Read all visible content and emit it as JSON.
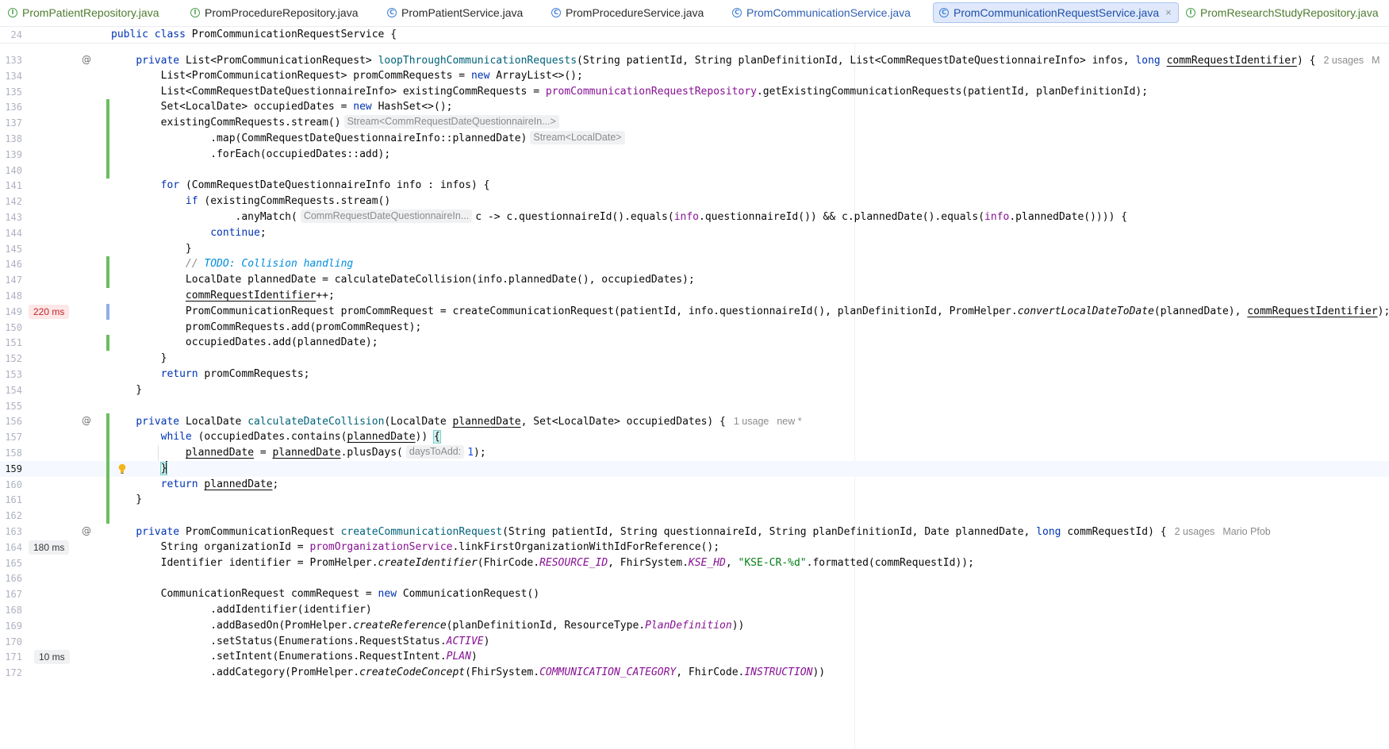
{
  "tabs": [
    {
      "label": "PromPatientRepository.java",
      "kind": "interface",
      "color": "green",
      "active": false
    },
    {
      "label": "PromProcedureRepository.java",
      "kind": "interface",
      "color": "dark",
      "active": false
    },
    {
      "label": "PromPatientService.java",
      "kind": "class",
      "color": "dark",
      "active": false
    },
    {
      "label": "PromProcedureService.java",
      "kind": "class",
      "color": "dark",
      "active": false
    },
    {
      "label": "PromCommunicationService.java",
      "kind": "class",
      "color": "blue",
      "active": false
    },
    {
      "label": "PromCommunicationRequestService.java",
      "kind": "class",
      "color": "active",
      "active": true
    },
    {
      "label": "PromResearchStudyRepository.java",
      "kind": "interface",
      "color": "green",
      "active": false
    }
  ],
  "tab_icons": {
    "interface": "I",
    "class": "C",
    "close": "×"
  },
  "gutter": {
    "override_icon": "@",
    "perf": {
      "149": "220 ms",
      "164": "180 ms",
      "171": "10 ms"
    }
  },
  "code": {
    "sticky_number": "24",
    "sticky_line": [
      [
        "public class ",
        "kw"
      ],
      [
        "PromCommunicationRequestService {",
        ""
      ]
    ],
    "lines": [
      {
        "n": "133",
        "seg": [
          [
            "    ",
            ""
          ],
          [
            "private ",
            "kw"
          ],
          [
            "List<PromCommunicationRequest> ",
            ""
          ],
          [
            "loopThroughCommunicationRequests",
            "fn"
          ],
          [
            "(String patientId, String planDefinitionId, List<CommRequestDateQuestionnaireInfo> infos, ",
            ""
          ],
          [
            "long ",
            "kw"
          ],
          [
            "commRequestIdentifier",
            "ul"
          ],
          [
            ") {",
            ""
          ],
          [
            "2 usages",
            "inlay"
          ],
          [
            "M",
            "inlay"
          ]
        ]
      },
      {
        "n": "134",
        "seg": [
          [
            "        List<PromCommunicationRequest> promCommRequests = ",
            ""
          ],
          [
            "new ",
            "kw"
          ],
          [
            "ArrayList<>();",
            ""
          ]
        ]
      },
      {
        "n": "135",
        "seg": [
          [
            "        List<CommRequestDateQuestionnaireInfo> existingCommRequests = ",
            ""
          ],
          [
            "promCommunicationRequestRepository",
            "field"
          ],
          [
            ".getExistingCommunicationRequests(patientId, planDefinitionId);",
            ""
          ]
        ]
      },
      {
        "n": "136",
        "seg": [
          [
            "        Set<LocalDate> occupiedDates = ",
            ""
          ],
          [
            "new ",
            "kw"
          ],
          [
            "HashSet<>();",
            ""
          ]
        ]
      },
      {
        "n": "137",
        "seg": [
          [
            "        existingCommRequests.stream()",
            ""
          ],
          [
            "Stream<CommRequestDateQuestionnaireIn...>",
            "hint"
          ]
        ]
      },
      {
        "n": "138",
        "seg": [
          [
            "                .map(CommRequestDateQuestionnaireInfo::plannedDate)",
            ""
          ],
          [
            "Stream<LocalDate>",
            "hint"
          ]
        ]
      },
      {
        "n": "139",
        "seg": [
          [
            "                .forEach(occupiedDates::add);",
            ""
          ]
        ]
      },
      {
        "n": "140",
        "seg": []
      },
      {
        "n": "141",
        "seg": [
          [
            "        ",
            ""
          ],
          [
            "for ",
            "kw"
          ],
          [
            "(CommRequestDateQuestionnaireInfo info : infos) {",
            ""
          ]
        ]
      },
      {
        "n": "142",
        "seg": [
          [
            "            ",
            ""
          ],
          [
            "if ",
            "kw"
          ],
          [
            "(existingCommRequests.stream()",
            ""
          ]
        ]
      },
      {
        "n": "143",
        "seg": [
          [
            "                    .anyMatch(",
            ""
          ],
          [
            "CommRequestDateQuestionnaireIn...",
            "hint"
          ],
          [
            "c -> c.questionnaireId().equals(",
            ""
          ],
          [
            "info",
            "field"
          ],
          [
            ".questionnaireId()) && c.plannedDate().equals(",
            ""
          ],
          [
            "info",
            "field"
          ],
          [
            ".plannedDate()))) {",
            ""
          ]
        ]
      },
      {
        "n": "144",
        "seg": [
          [
            "                ",
            ""
          ],
          [
            "continue",
            "kw"
          ],
          [
            ";",
            ""
          ]
        ]
      },
      {
        "n": "145",
        "seg": [
          [
            "            }",
            ""
          ]
        ]
      },
      {
        "n": "146",
        "seg": [
          [
            "            ",
            ""
          ],
          [
            "// ",
            "cmt"
          ],
          [
            "TODO: Collision handling",
            "todo"
          ]
        ]
      },
      {
        "n": "147",
        "seg": [
          [
            "            LocalDate plannedDate = calculateDateCollision(info.plannedDate(), occupiedDates);",
            ""
          ]
        ]
      },
      {
        "n": "148",
        "seg": [
          [
            "            ",
            ""
          ],
          [
            "commRequestIdentifier",
            "ul"
          ],
          [
            "++;",
            ""
          ]
        ]
      },
      {
        "n": "149",
        "seg": [
          [
            "            PromCommunicationRequest promCommRequest = createCommunicationRequest(patientId, info.questionnaireId(), planDefinitionId, PromHelper.",
            ""
          ],
          [
            "convertLocalDateToDate",
            "static"
          ],
          [
            "(plannedDate), ",
            ""
          ],
          [
            "commRequestIdentifier",
            "ul"
          ],
          [
            ");",
            ""
          ]
        ]
      },
      {
        "n": "150",
        "seg": [
          [
            "            promCommRequests.add(promCommRequest);",
            ""
          ]
        ]
      },
      {
        "n": "151",
        "seg": [
          [
            "            occupiedDates.add(plannedDate);",
            ""
          ]
        ]
      },
      {
        "n": "152",
        "seg": [
          [
            "        }",
            ""
          ]
        ]
      },
      {
        "n": "153",
        "seg": [
          [
            "        ",
            ""
          ],
          [
            "return ",
            "kw"
          ],
          [
            "promCommRequests;",
            ""
          ]
        ]
      },
      {
        "n": "154",
        "seg": [
          [
            "    }",
            ""
          ]
        ]
      },
      {
        "n": "155",
        "seg": []
      },
      {
        "n": "156",
        "seg": [
          [
            "    ",
            ""
          ],
          [
            "private ",
            "kw"
          ],
          [
            "LocalDate ",
            ""
          ],
          [
            "calculateDateCollision",
            "fn"
          ],
          [
            "(LocalDate ",
            ""
          ],
          [
            "plannedDate",
            "ul"
          ],
          [
            ", Set<LocalDate> occupiedDates) {",
            ""
          ],
          [
            "1 usage",
            "inlay"
          ],
          [
            "new *",
            "inlay"
          ]
        ]
      },
      {
        "n": "157",
        "seg": [
          [
            "        ",
            ""
          ],
          [
            "while ",
            "kw"
          ],
          [
            "(occupiedDates.contains(",
            ""
          ],
          [
            "plannedDate",
            "ul"
          ],
          [
            ")) ",
            ""
          ],
          [
            "{",
            "match"
          ]
        ]
      },
      {
        "n": "158",
        "seg": [
          [
            "            ",
            ""
          ],
          [
            "plannedDate",
            "ul"
          ],
          [
            " = ",
            ""
          ],
          [
            "plannedDate",
            "ul"
          ],
          [
            ".plusDays(",
            ""
          ],
          [
            "daysToAdd:",
            "hint"
          ],
          [
            "1",
            "num"
          ],
          [
            ");",
            ""
          ]
        ]
      },
      {
        "n": "159",
        "seg": [
          [
            "        ",
            ""
          ],
          [
            "}",
            "match"
          ],
          [
            "",
            "caret"
          ]
        ]
      },
      {
        "n": "160",
        "seg": [
          [
            "        ",
            ""
          ],
          [
            "return ",
            "kw"
          ],
          [
            "plannedDate",
            "ul"
          ],
          [
            ";",
            ""
          ]
        ]
      },
      {
        "n": "161",
        "seg": [
          [
            "    }",
            ""
          ]
        ]
      },
      {
        "n": "162",
        "seg": []
      },
      {
        "n": "163",
        "seg": [
          [
            "    ",
            ""
          ],
          [
            "private ",
            "kw"
          ],
          [
            "PromCommunicationRequest ",
            ""
          ],
          [
            "createCommunicationRequest",
            "fn"
          ],
          [
            "(String patientId, String questionnaireId, String planDefinitionId, Date plannedDate, ",
            ""
          ],
          [
            "long ",
            "kw"
          ],
          [
            "commRequestId) {",
            ""
          ],
          [
            "2 usages",
            "inlay"
          ],
          [
            "Mario Pfob",
            "inlay"
          ]
        ]
      },
      {
        "n": "164",
        "seg": [
          [
            "        String organizationId = ",
            ""
          ],
          [
            "promOrganizationService",
            "field"
          ],
          [
            ".linkFirstOrganizationWithIdForReference();",
            ""
          ]
        ]
      },
      {
        "n": "165",
        "seg": [
          [
            "        Identifier identifier = PromHelper.",
            ""
          ],
          [
            "createIdentifier",
            "static"
          ],
          [
            "(FhirCode.",
            ""
          ],
          [
            "RESOURCE_ID",
            "const"
          ],
          [
            ", FhirSystem.",
            ""
          ],
          [
            "KSE_HD",
            "const"
          ],
          [
            ", ",
            ""
          ],
          [
            "\"KSE-CR-%d\"",
            "str"
          ],
          [
            ".formatted(commRequestId));",
            ""
          ]
        ]
      },
      {
        "n": "166",
        "seg": []
      },
      {
        "n": "167",
        "seg": [
          [
            "        CommunicationRequest commRequest = ",
            ""
          ],
          [
            "new ",
            "kw"
          ],
          [
            "CommunicationRequest()",
            ""
          ]
        ]
      },
      {
        "n": "168",
        "seg": [
          [
            "                .addIdentifier(identifier)",
            ""
          ]
        ]
      },
      {
        "n": "169",
        "seg": [
          [
            "                .addBasedOn(PromHelper.",
            ""
          ],
          [
            "createReference",
            "static"
          ],
          [
            "(planDefinitionId, ResourceType.",
            ""
          ],
          [
            "PlanDefinition",
            "const"
          ],
          [
            "))",
            ""
          ]
        ]
      },
      {
        "n": "170",
        "seg": [
          [
            "                .setStatus(Enumerations.RequestStatus.",
            ""
          ],
          [
            "ACTIVE",
            "const"
          ],
          [
            ")",
            ""
          ]
        ]
      },
      {
        "n": "171",
        "seg": [
          [
            "                .setIntent(Enumerations.RequestIntent.",
            ""
          ],
          [
            "PLAN",
            "const"
          ],
          [
            ")",
            ""
          ]
        ]
      },
      {
        "n": "172",
        "seg": [
          [
            "                .addCategory(PromHelper.",
            ""
          ],
          [
            "createCodeConcept",
            "static"
          ],
          [
            "(FhirSystem.",
            ""
          ],
          [
            "COMMUNICATION_CATEGORY",
            "const"
          ],
          [
            ", FhirCode.",
            ""
          ],
          [
            "INSTRUCTION",
            "const"
          ],
          [
            "))",
            ""
          ]
        ]
      }
    ]
  }
}
